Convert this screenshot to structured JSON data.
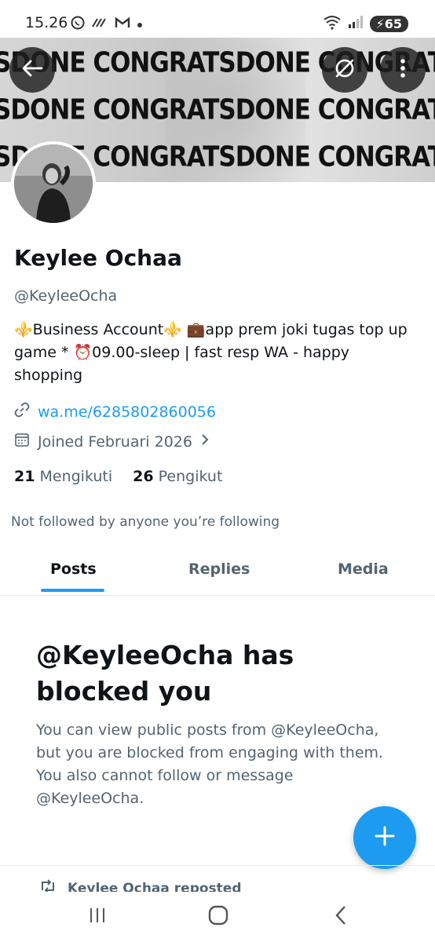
{
  "status_bar": {
    "time": "15.26",
    "battery": "65",
    "icons": [
      "whatsapp-icon",
      "signal-bars-icon",
      "gmail-icon",
      "dot-icon",
      "wifi-icon",
      "cell-signal-icon",
      "battery-icon"
    ]
  },
  "banner": {
    "text": "DONE CONGRATSDONE CONGRATSDONE CONGRATS",
    "row1": "SDONE CONGRATSDONE CONGRATSDONE CONGRATSDONE CONG",
    "row2": "SDONE CONGRATSDONE CONGRATSDONE CONGRATSDONE CONGR",
    "row3": "SDONE CONGRATSDONE CONGRATSDONE CONGRATSDONE CONGR"
  },
  "profile": {
    "name": "Keylee Ochaa",
    "handle": "@KeyleeOcha",
    "bio": "⚜️Business Account⚜️ 💼app prem joki tugas top up game * ⏰09.00-sleep | fast resp WA - happy shopping",
    "link": "wa.me/6285802860056",
    "joined": "Joined Februari 2026",
    "following_count": "21",
    "following_label": "Mengikuti",
    "followers_count": "26",
    "followers_label": "Pengikut",
    "not_followed": "Not followed by anyone you’re following"
  },
  "tabs": [
    {
      "label": "Posts",
      "active": true
    },
    {
      "label": "Replies",
      "active": false
    },
    {
      "label": "Media",
      "active": false
    }
  ],
  "blocked": {
    "title": "@KeyleeOcha has blocked you",
    "text": "You can view public posts from @KeyleeOcha, but you are blocked from engaging with them. You also cannot follow or message @KeyleeOcha."
  },
  "feed": {
    "repost_label": "Keylee Ochaa reposted"
  },
  "colors": {
    "accent": "#1d9bf0",
    "secondary_text": "#536471",
    "primary_text": "#0f1419"
  }
}
